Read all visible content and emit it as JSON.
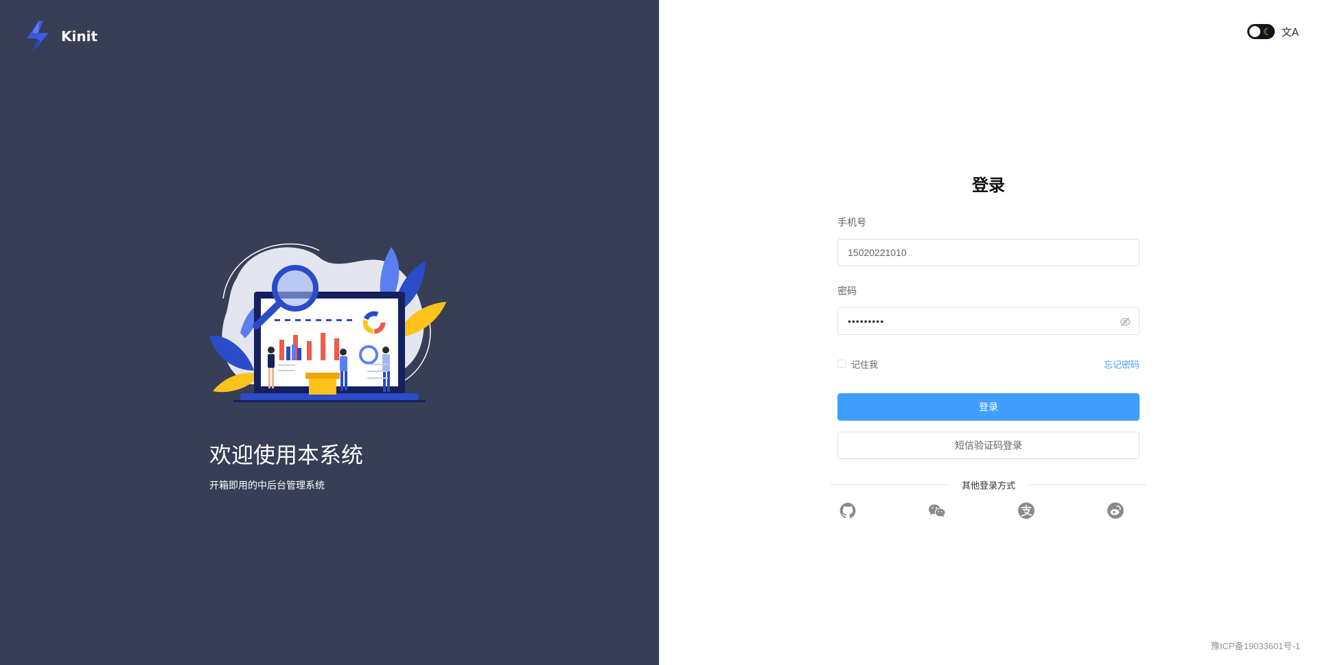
{
  "brand": {
    "name": "Kinit"
  },
  "welcome": {
    "title": "欢迎使用本系统",
    "subtitle": "开箱即用的中后台管理系统"
  },
  "toolbar": {
    "theme_icon": "moon-icon",
    "lang_icon": "translate-icon",
    "lang_glyph": "文A"
  },
  "login": {
    "title": "登录",
    "phone_label": "手机号",
    "phone_value": "15020221010",
    "password_label": "密码",
    "password_mask": "•••••••••",
    "remember_label": "记住我",
    "forgot_label": "忘记密码",
    "submit_label": "登录",
    "sms_label": "短信验证码登录",
    "other_methods": "其他登录方式"
  },
  "socials": [
    "github-icon",
    "wechat-icon",
    "alipay-icon",
    "weibo-icon"
  ],
  "footer": {
    "icp": "豫ICP备19033601号-1"
  },
  "colors": {
    "left_bg": "#373e55",
    "primary": "#409eff",
    "border": "#dcdfe6",
    "social_icon": "#8a8a8a"
  }
}
